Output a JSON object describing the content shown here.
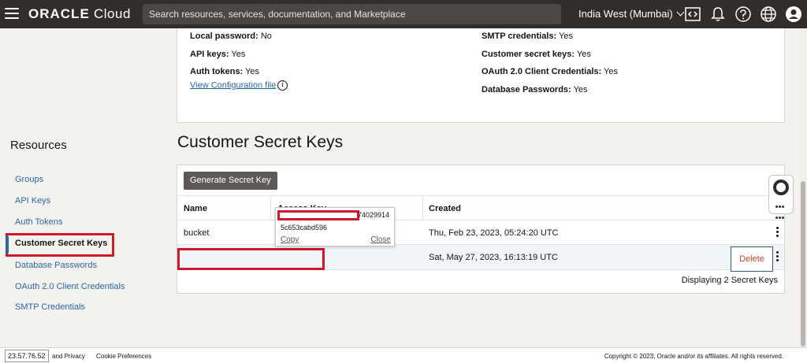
{
  "header": {
    "brand_bold": "ORACLE",
    "brand_light": " Cloud",
    "search_placeholder": "Search resources, services, documentation, and Marketplace",
    "region": "India West (Mumbai)",
    "icons": [
      "code-editor-icon",
      "bell-icon",
      "help-icon",
      "globe-icon",
      "user-avatar-icon"
    ]
  },
  "user_details": {
    "local_password_label": "Local password:",
    "local_password_value": " No",
    "api_keys_label": "API keys:",
    "api_keys_value": " Yes",
    "auth_tokens_label": "Auth tokens:",
    "auth_tokens_value": " Yes",
    "view_config": "View Configuration file",
    "smtp_label": "SMTP credentials:",
    "smtp_value": " Yes",
    "customer_secret_label": "Customer secret keys:",
    "customer_secret_value": " Yes",
    "oauth_label": "OAuth 2.0 Client Credentials:",
    "oauth_value": " Yes",
    "db_passwords_label": "Database Passwords:",
    "db_passwords_value": " Yes"
  },
  "sidebar": {
    "title": "Resources",
    "items": [
      {
        "label": "Groups"
      },
      {
        "label": "API Keys"
      },
      {
        "label": "Auth Tokens"
      },
      {
        "label": "Customer Secret Keys"
      },
      {
        "label": "Database Passwords"
      },
      {
        "label": "OAuth 2.0 Client Credentials"
      },
      {
        "label": "SMTP Credentials"
      }
    ]
  },
  "main": {
    "section_title": "Customer Secret Keys",
    "generate_button": "Generate Secret Key",
    "columns": [
      "Name",
      "Access Key",
      "Created"
    ],
    "rows": [
      {
        "name": "bucket",
        "created": "Thu, Feb 23, 2023, 05:24:20 UTC"
      },
      {
        "name": "",
        "created": "Sat, May 27, 2023, 16:13:19 UTC"
      }
    ],
    "delete_label": "Delete",
    "footer": "Displaying 2 Secret Keys",
    "popup": {
      "key_suffix": "74029914",
      "key_line2": "5c653cabd596",
      "copy": "Copy",
      "close": "Close"
    }
  },
  "bottom": {
    "ip": "23.57.76.52",
    "terms_privacy": "and Privacy",
    "cookie": "Cookie Preferences",
    "copyright": "Copyright © 2023, Oracle and/or its affiliates. All rights reserved."
  },
  "colors": {
    "topbar": "#312d2a",
    "link": "#2b66a7",
    "redaction": "#d1182a",
    "delete_text": "#c74634"
  }
}
